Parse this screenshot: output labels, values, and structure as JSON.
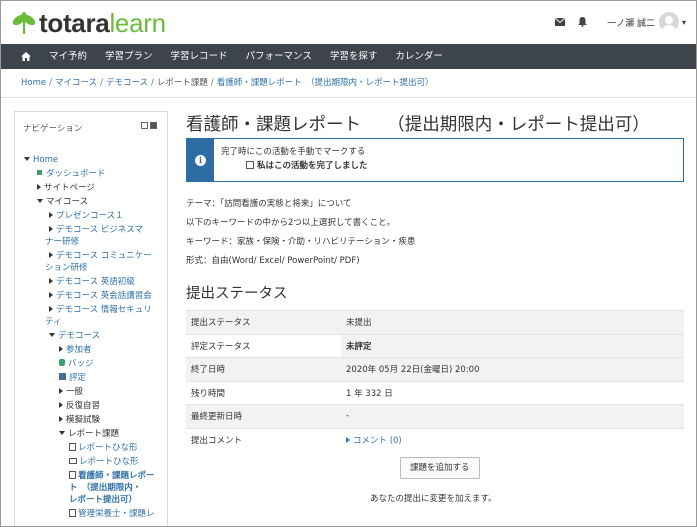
{
  "header": {
    "logo_bold": "totara",
    "logo_light": "learn",
    "user_name": "一ノ瀬 誠二"
  },
  "nav": {
    "items": [
      "マイ予約",
      "学習プラン",
      "学習レコード",
      "パフォーマンス",
      "学習を探す",
      "カレンダー"
    ]
  },
  "breadcrumb": [
    "Home",
    "マイコース",
    "デモコース",
    "レポート課題",
    "看護師・課題レポート　（提出期限内・レポート提出可）"
  ],
  "sidebar": {
    "title": "ナビゲーション",
    "home": "Home",
    "dashboard": "ダッシュボード",
    "site_pages": "サイトページ",
    "my_courses": "マイコース",
    "course_1": "プレゼンコース１",
    "course_2a": "デモコース ビジネスマ",
    "course_2b": "ナー研修",
    "course_3a": "デモコース コミュニケー",
    "course_3b": "ション研修",
    "course_4": "デモコース 英語初級",
    "course_5": "デモコース 英会話講習会",
    "course_6a": "デモコース 情報セキュリ",
    "course_6b": "ティ",
    "demo_course": "デモコース",
    "participants": "参加者",
    "badges": "バッジ",
    "grades": "評定",
    "general": "一般",
    "repeat": "反復自習",
    "mock_exam": "模擬試験",
    "report_task": "レポート課題",
    "template_1": "レポートひな形",
    "template_2": "レポートひな形",
    "current_1": "看護師・課題レポー",
    "current_2": "ト　（提出期限内・",
    "current_3": "レポート提出可）",
    "next_item": "管理栄養士・課題レ"
  },
  "main": {
    "title": "看護師・課題レポート　　（提出期限内・レポート提出可）",
    "completion_text": "完了時にこの活動を手動でマークする",
    "completion_check": "私はこの活動を完了しました",
    "intro": [
      "テーマ：「訪問看護の実態と将来」について",
      "以下のキーワードの中から2つ以上選択して書くこと。",
      "キーワード：家族・保険・介助・リハビリテーション・疾患",
      "形式：自由(Word/ Excel/ PowerPoint/ PDF)"
    ],
    "section_title": "提出ステータス",
    "rows": [
      {
        "label": "提出ステータス",
        "value": "未提出"
      },
      {
        "label": "評定ステータス",
        "value": "未評定"
      },
      {
        "label": "終了日時",
        "value": "2020年 05月 22日(金曜日) 20:00"
      },
      {
        "label": "残り時間",
        "value": "1 年 332 日"
      },
      {
        "label": "最終更新日時",
        "value": "-"
      },
      {
        "label": "提出コメント",
        "value": "コメント (0)"
      }
    ],
    "add_button": "課題を追加する",
    "add_note": "あなたの提出に変更を加えます。"
  },
  "colors": {
    "brand_green": "#6cbb3c",
    "navbar": "#3d444b",
    "link": "#3071a9",
    "info_blue": "#2e6da4"
  }
}
